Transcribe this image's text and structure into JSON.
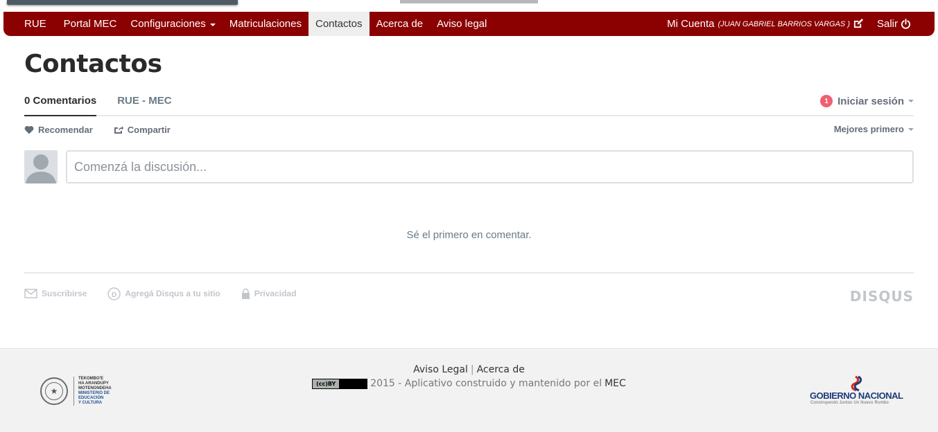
{
  "navbar": {
    "items": [
      {
        "label": "RUE"
      },
      {
        "label": "Portal MEC"
      },
      {
        "label": "Configuraciones"
      },
      {
        "label": "Matriculaciones"
      },
      {
        "label": "Contactos"
      },
      {
        "label": "Acerca de"
      },
      {
        "label": "Aviso legal"
      }
    ],
    "account_label": "Mi Cuenta",
    "account_name": "(JUAN GABRIEL BARRIOS VARGAS )",
    "logout_label": "Salir",
    "active_item": "Contactos",
    "color": "#8b0000"
  },
  "page": {
    "title": "Contactos"
  },
  "disqus": {
    "tabs": [
      {
        "label": "0 Comentarios"
      },
      {
        "label": "RUE - MEC"
      }
    ],
    "notification_count": "1",
    "login_label": "Iniciar sesión",
    "recommend_label": "Recomendar",
    "share_label": "Compartir",
    "sort_label": "Mejores primero",
    "composer_placeholder": "Comenzá la discusión...",
    "empty_message": "Sé el primero en comentar.",
    "footer": {
      "subscribe_label": "Suscribirse",
      "add_disqus_label": "Agregá Disqus a tu sitio",
      "privacy_label": "Privacidad",
      "brand": "DISQUS"
    }
  },
  "site_footer": {
    "legal_link": "Aviso Legal",
    "separator": "|",
    "about_link": "Acerca de",
    "copyright_text": "2015 - Aplicativo construido y mantenido por el",
    "mec_link": "MEC",
    "cc_label": "BY",
    "mec_logo_lines": [
      "TEKOMBO'E",
      "HA ARANDUPY",
      "MOTENONDEHA",
      "MINISTERIO DE",
      "EDUCACIÓN",
      "Y CULTURA"
    ],
    "gob_logo_text": "GOBIERNO NACIONAL",
    "gob_logo_sub": "Construyendo Juntos Un Nuevo Rumbo"
  }
}
